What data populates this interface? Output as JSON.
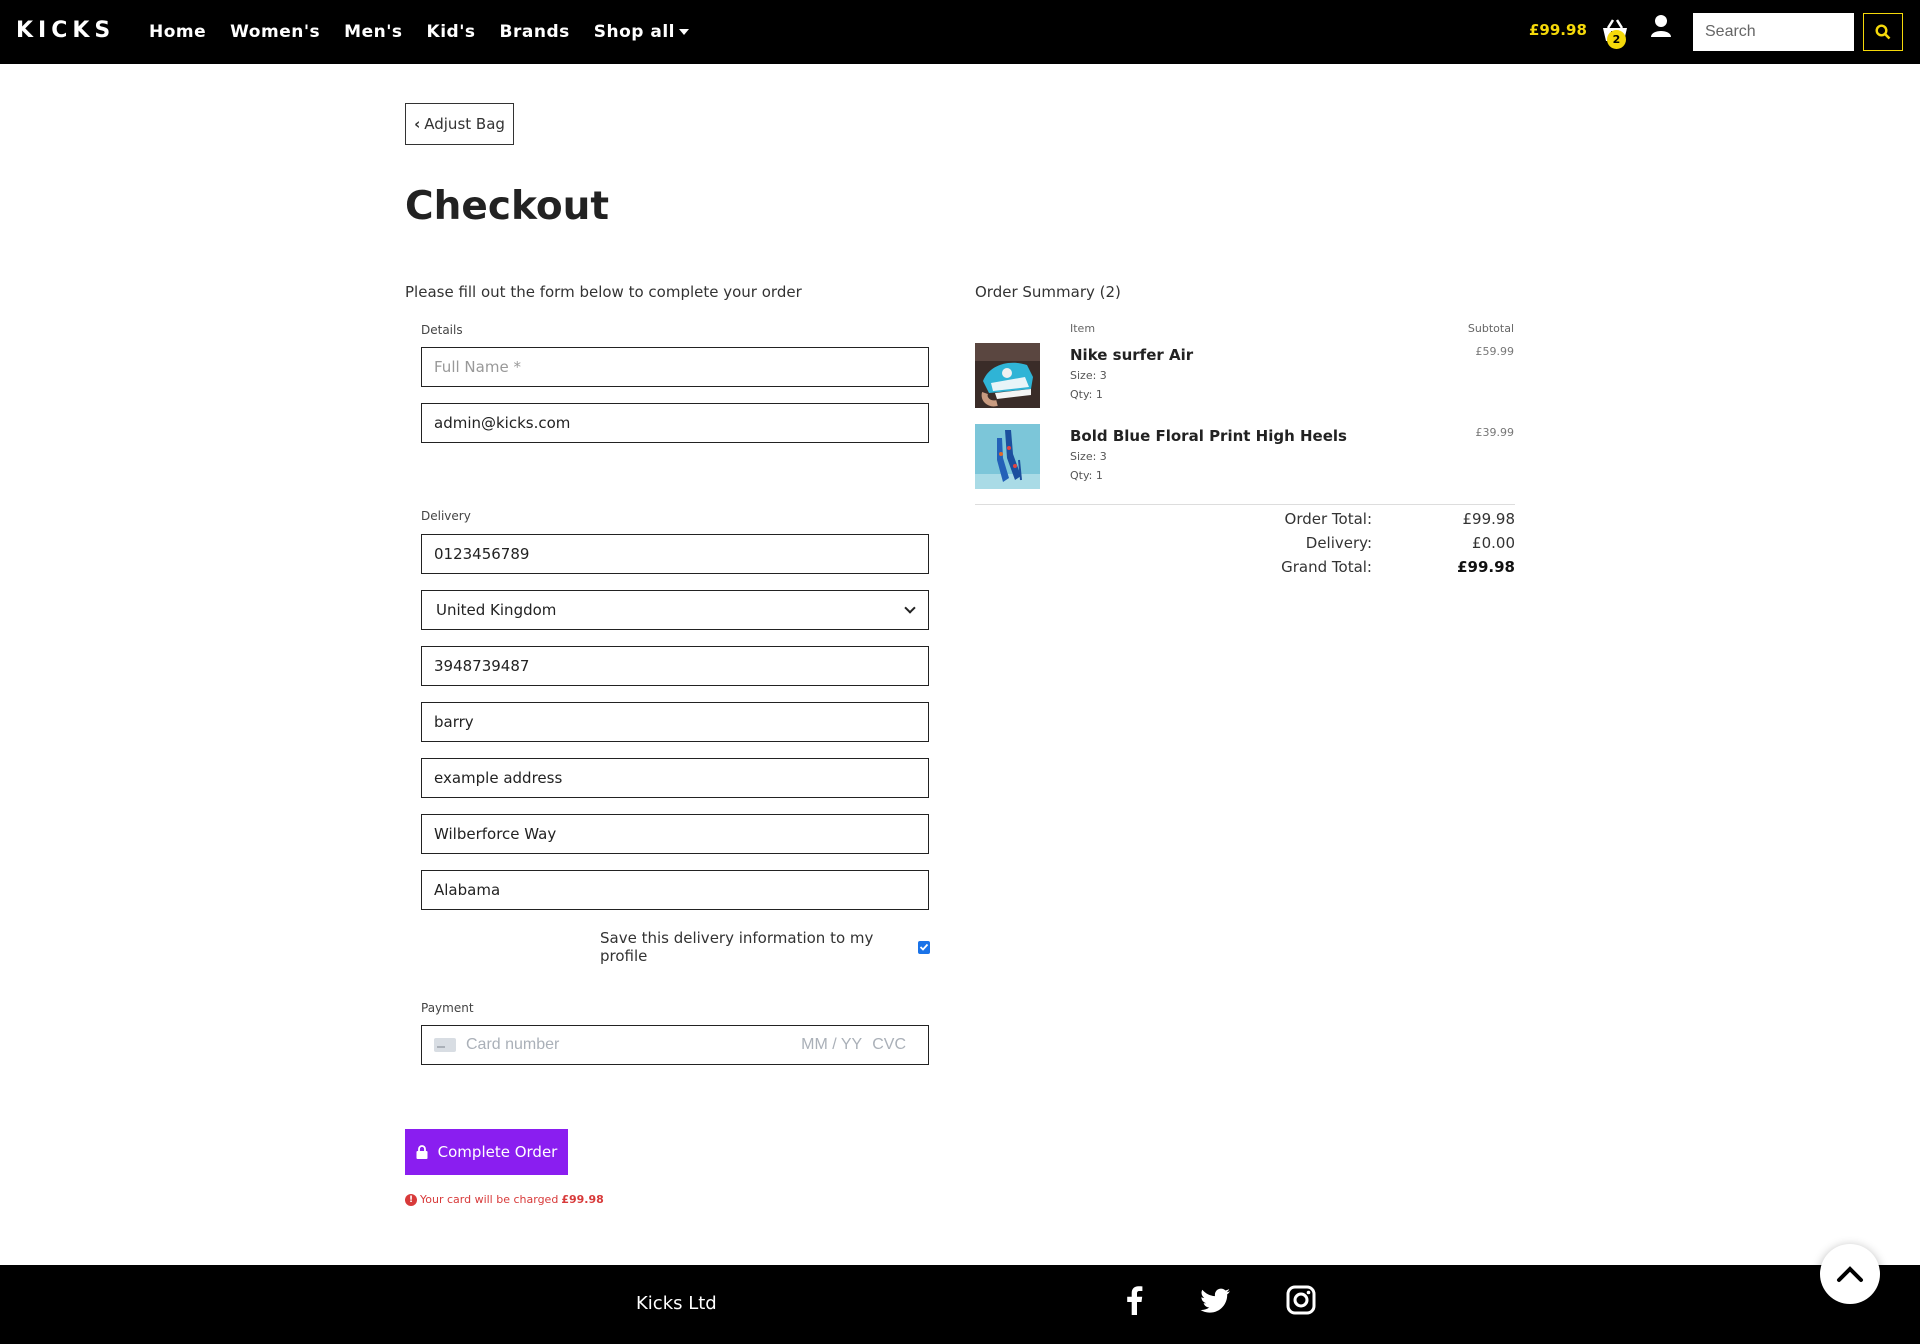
{
  "nav": {
    "brand": "KICKS",
    "links": [
      "Home",
      "Women's",
      "Men's",
      "Kid's",
      "Brands",
      "Shop all"
    ],
    "total": "£99.98",
    "cart_count": "2",
    "search_placeholder": "Search",
    "accent_color": "#f5d90a"
  },
  "page": {
    "adjust_bag_label": "Adjust Bag",
    "title": "Checkout",
    "intro": "Please fill out the form below to complete your order"
  },
  "form": {
    "details_label": "Details",
    "full_name_placeholder": "Full Name *",
    "email_value": "admin@kicks.com",
    "delivery_label": "Delivery",
    "phone_value": "0123456789",
    "country_value": "United Kingdom",
    "postcode_value": "3948739487",
    "town_value": "barry",
    "street1_value": "example address",
    "street2_value": "Wilberforce Way",
    "county_value": "Alabama",
    "save_info_label": "Save this delivery information to my profile",
    "save_info_checked": true,
    "payment_label": "Payment",
    "card_placeholder": "Card number",
    "card_exp_placeholder": "MM / YY",
    "card_cvc_placeholder": "CVC",
    "complete_label": "Complete Order",
    "charge_note": "Your card will be charged",
    "charge_amount": "£99.98",
    "button_color": "#8a1ef0"
  },
  "summary": {
    "title": "Order Summary (2)",
    "col_item": "Item",
    "col_subtotal": "Subtotal",
    "items": [
      {
        "name": "Nike surfer Air",
        "size": "Size: 3",
        "qty": "Qty: 1",
        "price": "£59.99"
      },
      {
        "name": "Bold Blue Floral Print High Heels",
        "size": "Size: 3",
        "qty": "Qty: 1",
        "price": "£39.99"
      }
    ],
    "order_total_label": "Order Total:",
    "order_total": "£99.98",
    "delivery_label": "Delivery:",
    "delivery": "£0.00",
    "grand_total_label": "Grand Total:",
    "grand_total": "£99.98"
  },
  "footer": {
    "brand": "Kicks Ltd",
    "social_icons": [
      "facebook-icon",
      "twitter-icon",
      "instagram-icon"
    ]
  }
}
